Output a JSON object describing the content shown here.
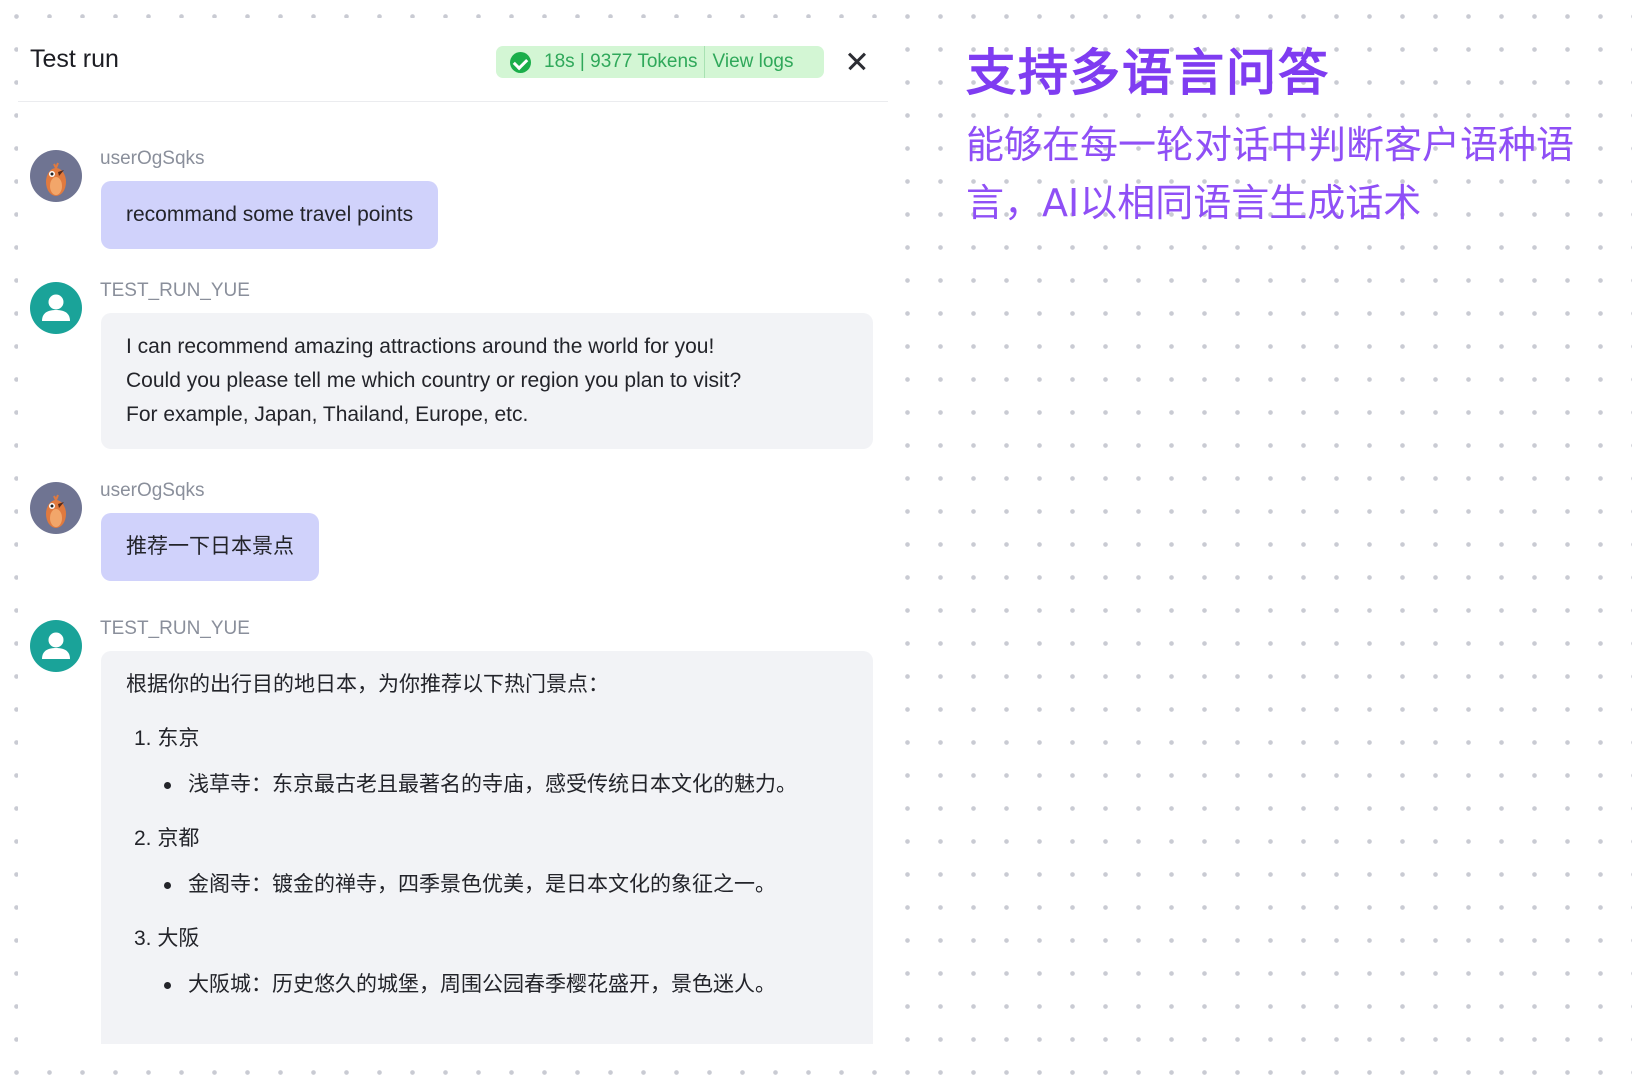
{
  "header": {
    "title": "Test run",
    "stats": "18s | 9377 Tokens",
    "view_logs": "View logs"
  },
  "messages": [
    {
      "sender": "userOgSqks",
      "text": "recommand some travel points"
    },
    {
      "sender": "TEST_RUN_YUE",
      "lines": [
        "I can recommend amazing attractions around the world for you!",
        "Could you please tell me which country or region you plan to visit?",
        "For example, Japan, Thailand, Europe, etc."
      ]
    },
    {
      "sender": "userOgSqks",
      "text": "推荐一下日本景点"
    },
    {
      "sender": "TEST_RUN_YUE",
      "intro": "根据你的出行目的地日本，为你推荐以下热门景点：",
      "items": [
        {
          "title": "1. 东京",
          "sub": "浅草寺：东京最古老且最著名的寺庙，感受传统日本文化的魅力。"
        },
        {
          "title": "2. 京都",
          "sub": "金阁寺：镀金的禅寺，四季景色优美，是日本文化的象征之一。"
        },
        {
          "title": "3. 大阪",
          "sub": "大阪城：历史悠久的城堡，周围公园春季樱花盛开，景色迷人。"
        }
      ]
    }
  ],
  "promo": {
    "title": "支持多语言问答",
    "description": "能够在每一轮对话中判断客户语种语言，AI以相同语言生成话术"
  },
  "colors": {
    "accent_purple": "#7f3cf1",
    "user_bubble": "#d0d2fb",
    "bot_bubble": "#f2f3f6",
    "success_green": "#1aae4a",
    "bot_avatar": "#1aa399"
  },
  "icons": {
    "success": "check-circle-icon",
    "close": "close-icon",
    "user_avatar": "bird-avatar",
    "bot_avatar": "person-avatar"
  }
}
